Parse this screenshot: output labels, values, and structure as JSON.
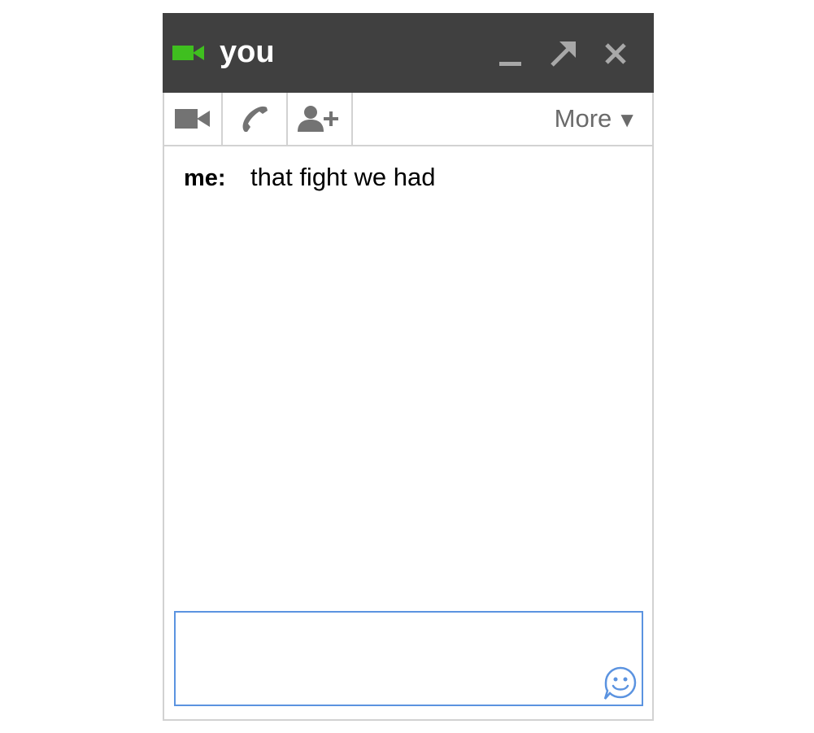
{
  "window": {
    "contact_name": "you",
    "status_icon": "video-camera-icon",
    "title_buttons": [
      "minimize-icon",
      "pop-out-icon",
      "close-icon"
    ]
  },
  "toolbar": {
    "icons": [
      "video-call-icon",
      "phone-icon",
      "add-person-icon"
    ],
    "more_label": "More",
    "more_arrow": "▼"
  },
  "messages": [
    {
      "sender": "me:",
      "text": "that fight we had"
    }
  ],
  "compose": {
    "value": "",
    "emoji_icon": "smiley-icon"
  },
  "colors": {
    "title_bar": "#404040",
    "status_green": "#3fbf1f",
    "compose_border": "#5b93e0",
    "icon_gray": "#737373"
  }
}
